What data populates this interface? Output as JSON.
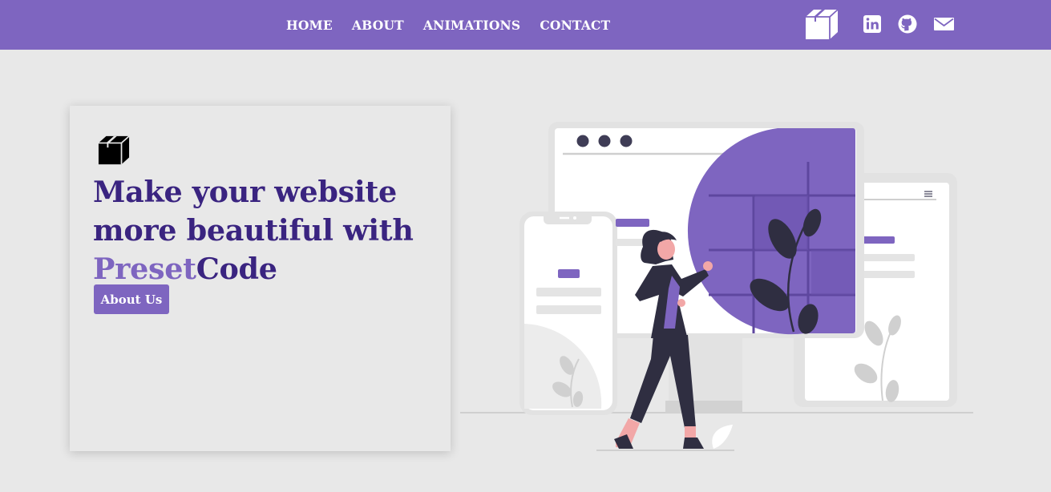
{
  "colors": {
    "brand_purple": "#7e65c0",
    "headline_dark": "#3a2480",
    "background": "#e8e8e8"
  },
  "nav": {
    "links": [
      "HOME",
      "ABOUT",
      "ANIMATIONS",
      "CONTACT"
    ],
    "logo_icon": "box-icon",
    "social_icons": [
      "linkedin-icon",
      "github-icon",
      "mail-icon"
    ]
  },
  "hero": {
    "headline_line1": "Make your website",
    "headline_line2": "more beautiful with",
    "headline_accent": "Preset",
    "headline_end": "Code",
    "button_label": "About Us",
    "logo_icon": "box-icon"
  },
  "illustration": {
    "name": "woman-presenting-website-illustration"
  }
}
